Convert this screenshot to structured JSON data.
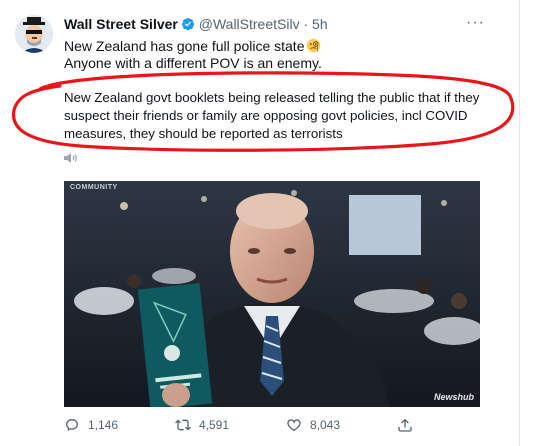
{
  "tweet": {
    "author_name": "Wall Street Silver",
    "handle": "@WallStreetSilv",
    "separator": "·",
    "time": "5h",
    "line1": "New Zealand has gone full police state",
    "line2": "Anyone with a different POV is an enemy.",
    "highlight_line1": "New Zealand govt booklets being released telling the public that if they",
    "highlight_line2": "suspect their friends or family are opposing govt policies, incl COVID",
    "highlight_line3": "measures, they should be reported as terrorists",
    "annotation_color": "#e8161b"
  },
  "video": {
    "overlay_top": "COMMUNITY",
    "watermark": "Newshub",
    "audio_state": "muted"
  },
  "actions": {
    "replies": "1,146",
    "retweets": "4,591",
    "likes": "8,043"
  },
  "icons": [
    "avatar-icon",
    "verified-badge-icon",
    "more-options-icon",
    "speaker-icon",
    "reply-icon",
    "retweet-icon",
    "like-icon",
    "share-icon"
  ]
}
